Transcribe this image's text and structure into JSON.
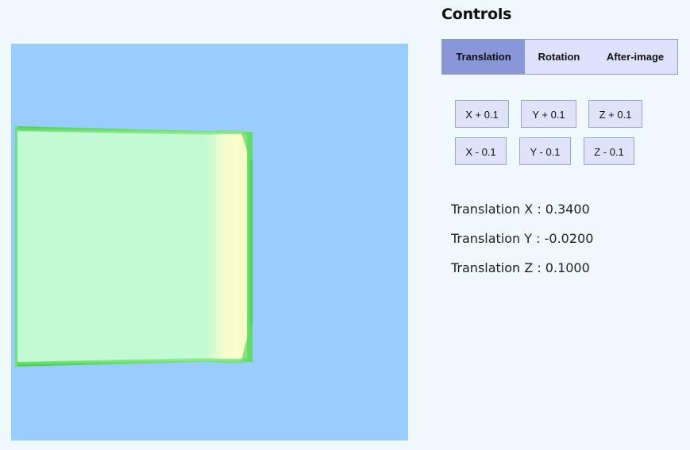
{
  "controls_title": "Controls",
  "tabs": [
    {
      "label": "Translation",
      "active": true
    },
    {
      "label": "Rotation",
      "active": false
    },
    {
      "label": "After-image",
      "active": false
    }
  ],
  "buttons": {
    "x_plus": "X + 0.1",
    "y_plus": "Y + 0.1",
    "z_plus": "Z + 0.1",
    "x_minus": "X - 0.1",
    "y_minus": "Y - 0.1",
    "z_minus": "Z - 0.1"
  },
  "readouts": {
    "x": {
      "label": "Translation X : ",
      "value": "0.3400"
    },
    "y": {
      "label": "Translation Y : ",
      "value": "-0.0200"
    },
    "z": {
      "label": "Translation Z : ",
      "value": "0.1000"
    }
  },
  "colors": {
    "viewport_background": "#99ccff",
    "panel_background": "#eef8fd",
    "active_tab": "#8897d8",
    "inactive_tab": "#dde1fb",
    "object_face": "#c0fad2",
    "object_edge": "#4bd25a",
    "object_highlight": "#fdfccc"
  }
}
